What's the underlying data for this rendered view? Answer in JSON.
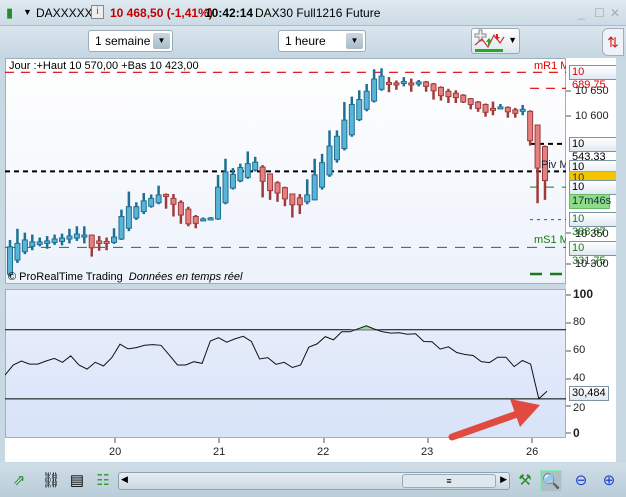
{
  "window": {
    "symbol": "DAXXXXX",
    "last_price": "10 468,50 (-1,41%)",
    "time": "10:42:14",
    "instrument": "DAX30 Full1216 Future",
    "icons": [
      "candlestick-icon",
      "chevron-down-icon",
      "info-icon",
      "minimize-icon",
      "maximize-icon",
      "close-icon"
    ]
  },
  "toolbar": {
    "period": "1 semaine",
    "interval": "1 heure",
    "indicator_icon": "add-indicator-icon"
  },
  "chart": {
    "header": "Jour :+Haut 10 570,00 +Bas 10 423,00",
    "copyright": "© ProRealTime Trading",
    "realtime": "Données en temps réel",
    "labels": {
      "mr1": "mR1 M",
      "piv": "Piv M",
      "ms1": "mS1 M"
    },
    "price_boxes": {
      "mr1": "10 689,75",
      "r_mid": "10 543,33",
      "piv": "10 487,33",
      "last": "10 468,50",
      "s_mid": "10 455,00",
      "timer": "17m46s",
      "s_low": "10 388,67",
      "ms1": "10 331,75"
    },
    "price_ticks": [
      "10 650",
      "10 600",
      "10 350",
      "10 300"
    ],
    "rsi_ticks": [
      "100",
      "80",
      "60",
      "40",
      "20",
      "0"
    ],
    "rsi_value": "30,484",
    "x_ticks": [
      "20",
      "21",
      "22",
      "23",
      "26"
    ],
    "colors": {
      "bull": "#5ab4d8",
      "bull_edge": "#1e6f93",
      "bear": "#e58080",
      "bear_edge": "#9e3a3a",
      "resistance": "#e00000",
      "pivot": "#000000",
      "support": "#1a7a1a"
    }
  },
  "chart_data": [
    {
      "type": "candlestick",
      "ylim": [
        10257,
        10719
      ],
      "levels": {
        "mR1": 10689.75,
        "r_mid": 10543.33,
        "pivot": 10487.33,
        "s_mid": 10455.0,
        "s_low": 10388.67,
        "mS1": 10331.75
      },
      "x_ticks": [
        "20",
        "21",
        "22",
        "23",
        "26"
      ],
      "ohlc": [
        [
          10277,
          10347,
          10272,
          10333
        ],
        [
          10306,
          10370,
          10300,
          10340
        ],
        [
          10323,
          10362,
          10318,
          10347
        ],
        [
          10334,
          10358,
          10326,
          10343
        ],
        [
          10338,
          10352,
          10334,
          10343
        ],
        [
          10340,
          10355,
          10329,
          10345
        ],
        [
          10342,
          10358,
          10337,
          10349
        ],
        [
          10344,
          10360,
          10336,
          10351
        ],
        [
          10349,
          10370,
          10340,
          10355
        ],
        [
          10351,
          10375,
          10345,
          10359
        ],
        [
          10355,
          10375,
          10340,
          10357
        ],
        [
          10357,
          10358,
          10313,
          10331
        ],
        [
          10345,
          10355,
          10325,
          10340
        ],
        [
          10344,
          10352,
          10326,
          10340
        ],
        [
          10342,
          10371,
          10339,
          10353
        ],
        [
          10349,
          10409,
          10347,
          10395
        ],
        [
          10371,
          10446,
          10365,
          10415
        ],
        [
          10392,
          10424,
          10388,
          10415
        ],
        [
          10405,
          10443,
          10400,
          10427
        ],
        [
          10416,
          10440,
          10413,
          10432
        ],
        [
          10423,
          10458,
          10420,
          10439
        ],
        [
          10440,
          10442,
          10411,
          10438
        ],
        [
          10432,
          10441,
          10395,
          10420
        ],
        [
          10424,
          10428,
          10380,
          10398
        ],
        [
          10410,
          10415,
          10375,
          10380
        ],
        [
          10395,
          10398,
          10371,
          10381
        ],
        [
          10388,
          10393,
          10386,
          10390
        ],
        [
          10389,
          10394,
          10387,
          10392
        ],
        [
          10390,
          10480,
          10388,
          10455
        ],
        [
          10423,
          10513,
          10420,
          10486
        ],
        [
          10453,
          10494,
          10450,
          10481
        ],
        [
          10468,
          10503,
          10465,
          10495
        ],
        [
          10475,
          10528,
          10472,
          10503
        ],
        [
          10490,
          10517,
          10487,
          10506
        ],
        [
          10496,
          10500,
          10434,
          10467
        ],
        [
          10482,
          10482,
          10429,
          10448
        ],
        [
          10464,
          10467,
          10425,
          10443
        ],
        [
          10454,
          10456,
          10416,
          10431
        ],
        [
          10441,
          10441,
          10393,
          10419
        ],
        [
          10433,
          10441,
          10400,
          10419
        ],
        [
          10425,
          10471,
          10420,
          10439
        ],
        [
          10429,
          10513,
          10428,
          10480
        ],
        [
          10455,
          10523,
          10450,
          10505
        ],
        [
          10480,
          10571,
          10476,
          10539
        ],
        [
          10511,
          10571,
          10505,
          10559
        ],
        [
          10534,
          10629,
          10530,
          10592
        ],
        [
          10562,
          10640,
          10558,
          10624
        ],
        [
          10593,
          10653,
          10590,
          10634
        ],
        [
          10614,
          10666,
          10610,
          10651
        ],
        [
          10631,
          10696,
          10628,
          10676
        ],
        [
          10655,
          10698,
          10652,
          10682
        ],
        [
          10669,
          10680,
          10649,
          10666
        ],
        [
          10668,
          10673,
          10654,
          10665
        ],
        [
          10667,
          10680,
          10661,
          10671
        ],
        [
          10668,
          10677,
          10650,
          10665
        ],
        [
          10667,
          10674,
          10661,
          10670
        ],
        [
          10670,
          10672,
          10650,
          10661
        ],
        [
          10666,
          10668,
          10634,
          10652
        ],
        [
          10659,
          10661,
          10632,
          10642
        ],
        [
          10651,
          10656,
          10627,
          10640
        ],
        [
          10647,
          10653,
          10627,
          10638
        ],
        [
          10643,
          10645,
          10627,
          10629
        ],
        [
          10636,
          10637,
          10614,
          10624
        ],
        [
          10629,
          10631,
          10609,
          10616
        ],
        [
          10624,
          10626,
          10599,
          10608
        ],
        [
          10616,
          10630,
          10602,
          10615
        ],
        [
          10617,
          10625,
          10614,
          10619
        ],
        [
          10618,
          10620,
          10597,
          10609
        ],
        [
          10613,
          10617,
          10597,
          10606
        ],
        [
          10610,
          10623,
          10602,
          10614
        ],
        [
          10610,
          10612,
          10540,
          10550
        ],
        [
          10582,
          10582,
          10422,
          10494
        ],
        [
          10538,
          10540,
          10429,
          10468.5
        ]
      ]
    },
    {
      "type": "line",
      "ylim": [
        0,
        100
      ],
      "thresholds": [
        75,
        25
      ],
      "values": [
        42.2,
        49.5,
        52.4,
        50.2,
        50.2,
        52.4,
        54.3,
        51.5,
        56.2,
        49.5,
        46.6,
        51.5,
        48.8,
        54.9,
        64.6,
        61.2,
        62.1,
        63.8,
        64.3,
        63.8,
        56.8,
        49.5,
        49.5,
        51.9,
        50.7,
        66.9,
        69.3,
        66.0,
        68.4,
        70.3,
        66.5,
        53.9,
        54.9,
        50.0,
        51.5,
        47.7,
        49.5,
        62.4,
        64.8,
        70.1,
        67.7,
        73.5,
        73.5,
        75.7,
        77.9,
        75.5,
        73.5,
        72.6,
        72.8,
        71.8,
        72.1,
        66.5,
        66.3,
        61.0,
        62.7,
        58.6,
        57.1,
        56.4,
        52.0,
        51.3,
        55.2,
        55.2,
        48.4,
        52.8,
        50.2,
        25.1,
        30.484
      ]
    }
  ],
  "bottom_toolbar": {
    "icons": [
      "export-icon",
      "link-icon",
      "report-icon",
      "order-book-icon",
      "scroll-left-icon",
      "scrollbar-thumb-icon",
      "scroll-right-icon",
      "tools-icon",
      "auto-zoom-icon",
      "zoom-out-icon",
      "zoom-in-icon"
    ]
  }
}
